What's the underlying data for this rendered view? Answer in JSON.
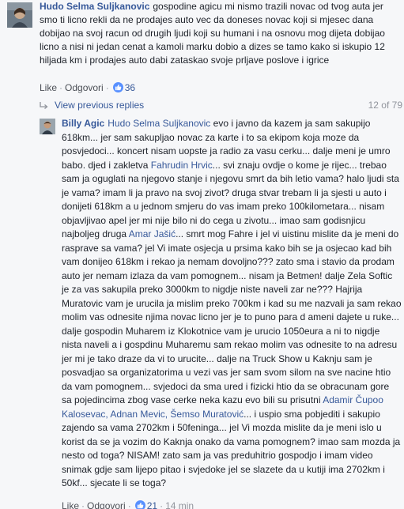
{
  "comment1": {
    "author": "Hudo Selma Suljkanovic",
    "text": "gospodine agicu mi nismo trazili novac od tvog auta jer smo ti licno rekli da ne prodajes auto vec da doneses novac koji si mjesec dana dobijao na svoj racun od drugih ljudi koji su humani i na osnovu mog dijeta dobijao licno a nisi ni jedan cenat a kamoli marku dobio a dizes se tamo kako si iskupio 12 hiljada km i prodajes auto dabi zataskao svoje prljave poslove i igrice",
    "actions": {
      "like": "Like",
      "reply": "Odgovori",
      "like_count": "36"
    }
  },
  "replies": {
    "view_previous": "View previous replies",
    "counter": "12 of 79"
  },
  "comment2": {
    "author": "Billy Agic",
    "tag_recipient": "Hudo Selma Suljkanovic",
    "segments": {
      "s1": "evo i javno da kazem ja sam sakupijo 618km... jer sam sakupljao novac za karte i to sa ekipom koja moze da posvjedoci... koncert nisam uopste ja radio za vasu cerku... dalje meni je umro babo. djed i zakletva",
      "t1": "Fahrudin Hrvic",
      "s2": "... svi znaju ovdje o kome je rijec... trebao sam ja oguglati na njegovo stanje i njegovu smrt da bih letio vama? halo ljudi sta je vama? imam li ja pravo na svoj zivot? druga stvar trebam li ja sjesti u auto i donijeti 618km a u jednom smjeru do vas imam preko 100kilometara... nisam objavljivao apel jer mi nije bilo ni do cega u zivotu... imao sam godisnjicu najboljeg druga",
      "t2": "Amar Jašić",
      "s3": "... smrt mog Fahre i jel vi uistinu mislite da je meni do rasprave sa vama? jel Vi imate osjecja u prsima kako bih se ja osjecao kad bih vam donijeo 618km i rekao ja nemam dovoljno??? zato sma i stavio da prodam auto jer nemam izlaza da vam pomognem... nisam ja Betmen! dalje Zela Softic je za vas sakupila preko 3000km to nigdje niste naveli zar ne??? Hajrija Muratovic vam je urucila ja mislim preko 700km i kad su me nazvali ja sam rekao molim vas odnesite njima novac licno jer je to puno para d ameni dajete u ruke... dalje gospodin Muharem iz Klokotnice vam je urucio 1050eura a ni to nigdje nista naveli a i gospdinu Muharemu sam rekao molim vas odnesite to na adresu jer mi je tako draze da vi to urucite... dalje na Truck Show u Kaknju sam je posvadjao sa organizatorima u vezi vas jer sam svom silom na sve nacine htio da vam pomognem... svjedoci da sma ured i fizicki htio da se obracunam gore sa pojedincima zbog vase cerke neka kazu evo bili su prisutni",
      "t3": "Adamir Čupoo Kalosevac, Adnan Mevic, Šemso Muratović",
      "s4": "... i uspio sma pobjediti i sakupio zajendo sa vama 2702km i 50feninga... jel Vi mozda mislite da je meni islo u korist da se ja vozim do Kaknja onako da vama pomognem? imao sam mozda ja nesto od toga? NISAM! zato sam ja vas preduhitrio gospodjo i imam video snimak gdje sam lijepo pitao i svjedoke jel se slazete da u kutiji ima 2702km i 50kf... sjecate li se toga?"
    },
    "actions": {
      "like": "Like",
      "reply": "Odgovori",
      "like_count": "21",
      "time": "14 min"
    }
  },
  "colors": {
    "link": "#365899",
    "muted": "#90949c",
    "background": "#f6f7f9",
    "like_blue": "#5890ff"
  }
}
